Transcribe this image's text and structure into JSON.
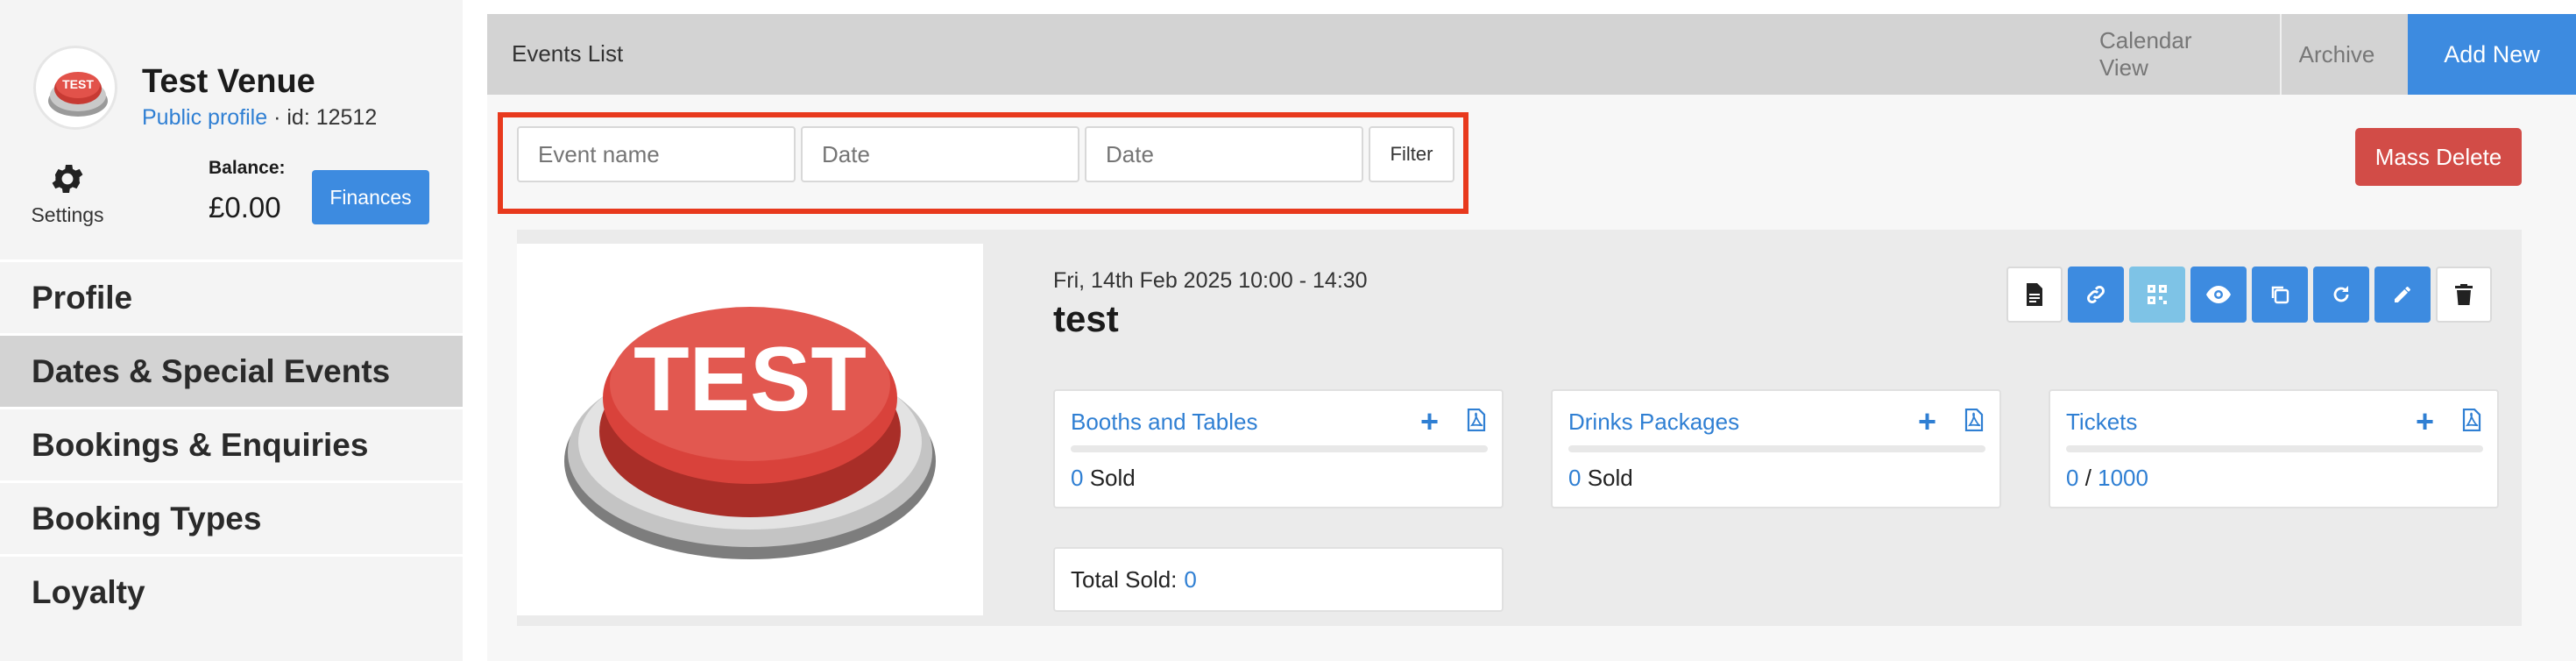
{
  "venue": {
    "name": "Test Venue",
    "profile_link": "Public profile",
    "id_text": " · id: 12512",
    "avatar_label": "TEST",
    "settings_label": "Settings",
    "balance_label": "Balance:",
    "balance_value": "£0.00",
    "finances_label": "Finances"
  },
  "nav": {
    "items": [
      {
        "label": "Profile"
      },
      {
        "label": "Dates & Special Events"
      },
      {
        "label": "Bookings & Enquiries"
      },
      {
        "label": "Booking Types"
      },
      {
        "label": "Loyalty"
      }
    ]
  },
  "header": {
    "title": "Events List",
    "tabs": {
      "calendar": "Calendar View",
      "archive": "Archive",
      "add_new": "Add New"
    }
  },
  "filters": {
    "event_name_placeholder": "Event name",
    "date_from_placeholder": "Date",
    "date_to_placeholder": "Date",
    "filter_label": "Filter",
    "mass_delete_label": "Mass Delete"
  },
  "event": {
    "image_label": "TEST",
    "date": "Fri, 14th Feb 2025 10:00 - 14:30",
    "name": "test",
    "actions": [
      "document-icon",
      "link-icon",
      "qr-code-icon",
      "eye-icon",
      "copy-icon",
      "refresh-icon",
      "pencil-icon",
      "trash-icon"
    ],
    "panels": [
      {
        "title": "Booths and Tables",
        "count": "0",
        "suffix": " Sold"
      },
      {
        "title": "Drinks Packages",
        "count": "0",
        "suffix": " Sold"
      },
      {
        "title": "Tickets",
        "count": "0",
        "separator": " / ",
        "total": "1000"
      }
    ],
    "total_sold_label": "Total Sold:",
    "total_sold_value": "0"
  },
  "colors": {
    "accent": "#3d8be0",
    "link": "#2f7fd3",
    "danger": "#d24c47",
    "highlight": "#e8391d",
    "light_blue": "#7ec3e6"
  }
}
